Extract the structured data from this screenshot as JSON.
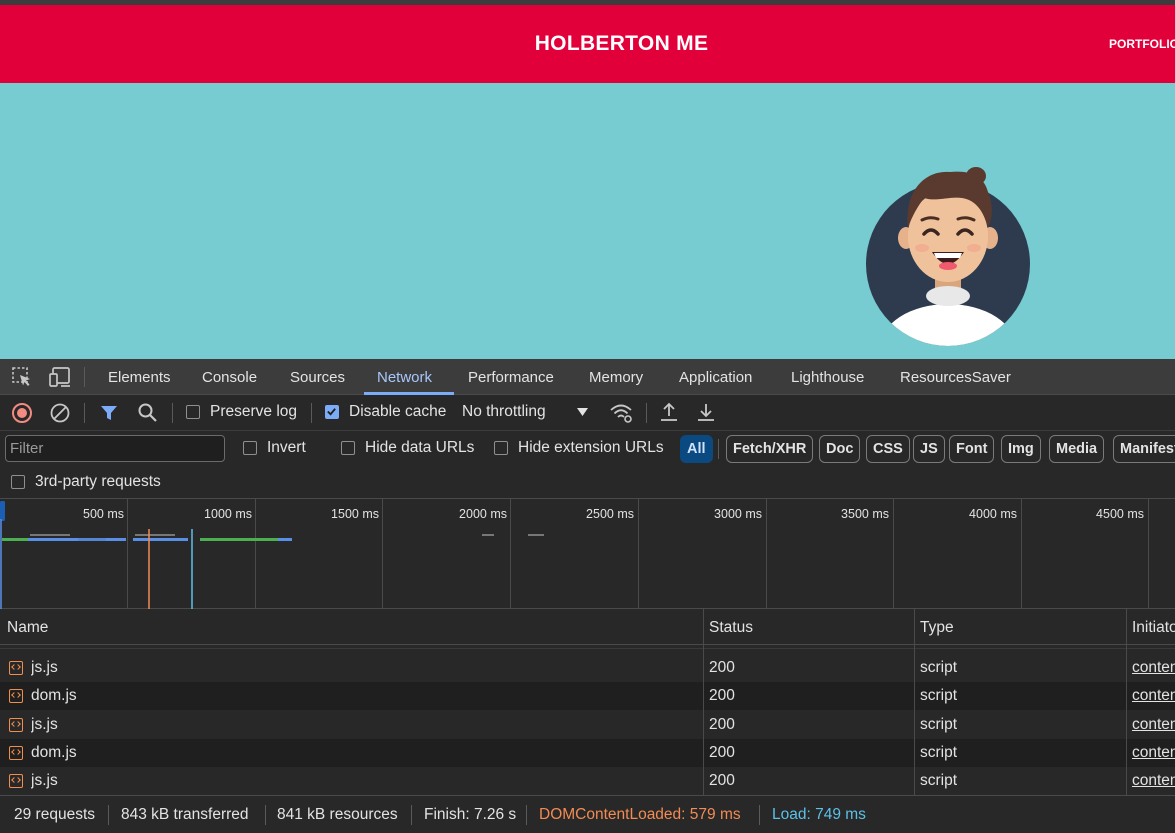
{
  "website": {
    "title": "HOLBERTON ME",
    "nav_item": "PORTFOLIO",
    "colors": {
      "header": "#e2003b",
      "hero": "#76ccd0"
    }
  },
  "devtools": {
    "tabs": [
      {
        "label": "Elements"
      },
      {
        "label": "Console"
      },
      {
        "label": "Sources"
      },
      {
        "label": "Network",
        "active": true
      },
      {
        "label": "Performance"
      },
      {
        "label": "Memory"
      },
      {
        "label": "Application"
      },
      {
        "label": "Lighthouse"
      },
      {
        "label": "ResourcesSaver"
      }
    ],
    "toolbar": {
      "preserve_log": "Preserve log",
      "preserve_log_checked": false,
      "disable_cache": "Disable cache",
      "disable_cache_checked": true,
      "throttling": "No throttling"
    },
    "filter": {
      "placeholder": "Filter",
      "invert": "Invert",
      "hide_data_urls": "Hide data URLs",
      "hide_extension_urls": "Hide extension URLs",
      "type_filters": [
        "All",
        "Fetch/XHR",
        "Doc",
        "CSS",
        "JS",
        "Font",
        "Img",
        "Media",
        "Manifest"
      ],
      "active_type": "All",
      "third_party": "3rd-party requests"
    },
    "timeline": {
      "ticks": [
        "500 ms",
        "1000 ms",
        "1500 ms",
        "2000 ms",
        "2500 ms",
        "3000 ms",
        "3500 ms",
        "4000 ms",
        "4500 ms"
      ]
    },
    "table": {
      "headers": {
        "name": "Name",
        "status": "Status",
        "type": "Type",
        "initiator": "Initiator"
      },
      "rows": [
        {
          "name": "js.js",
          "status": "200",
          "type": "script",
          "initiator": "content"
        },
        {
          "name": "dom.js",
          "status": "200",
          "type": "script",
          "initiator": "content"
        },
        {
          "name": "js.js",
          "status": "200",
          "type": "script",
          "initiator": "content"
        },
        {
          "name": "dom.js",
          "status": "200",
          "type": "script",
          "initiator": "content"
        },
        {
          "name": "js.js",
          "status": "200",
          "type": "script",
          "initiator": "content"
        }
      ]
    },
    "status": {
      "requests": "29 requests",
      "transferred": "843 kB transferred",
      "resources": "841 kB resources",
      "finish": "Finish: 7.26 s",
      "dom_content_loaded": "DOMContentLoaded: 579 ms",
      "load": "Load: 749 ms",
      "colors": {
        "dom_content_loaded": "#f28b54",
        "load": "#5cc1e8"
      }
    }
  }
}
